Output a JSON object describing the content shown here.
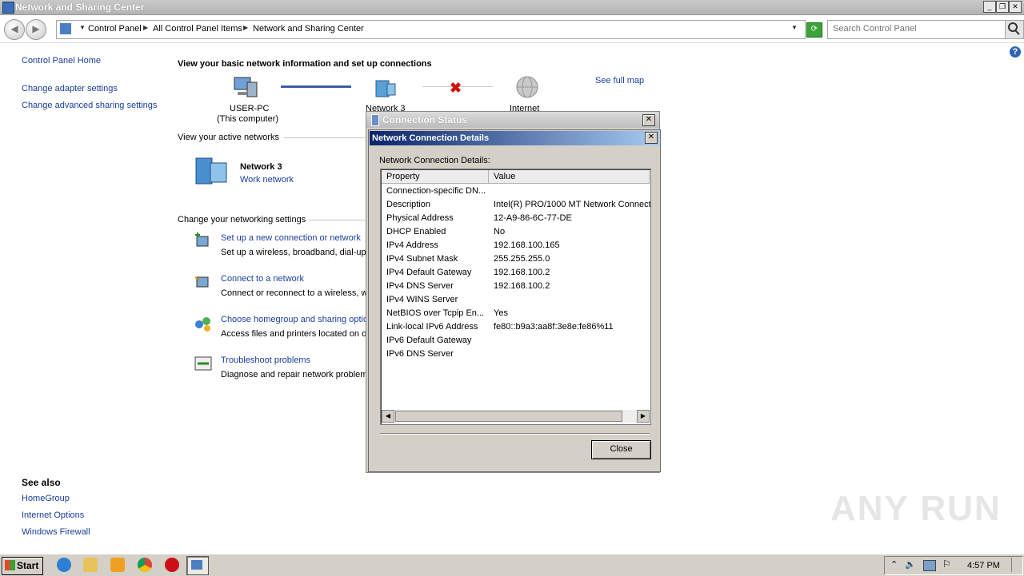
{
  "window": {
    "title": "Network and Sharing Center"
  },
  "address_bar": {
    "crumbs": [
      "Control Panel",
      "All Control Panel Items",
      "Network and Sharing Center"
    ],
    "search_placeholder": "Search Control Panel"
  },
  "left_pane": {
    "links": [
      "Control Panel Home",
      "Change adapter settings",
      "Change advanced sharing settings"
    ],
    "see_also_title": "See also",
    "see_also": [
      "HomeGroup",
      "Internet Options",
      "Windows Firewall"
    ]
  },
  "main": {
    "heading": "View your basic network information and set up connections",
    "see_full_map": "See full map",
    "map": {
      "computer_name": "USER-PC",
      "computer_sub": "(This computer)",
      "network": "Network  3",
      "internet": "Internet"
    },
    "active_networks_label": "View your active networks",
    "active_network": {
      "name": "Network  3",
      "type": "Work network"
    },
    "change_settings_label": "Change your networking settings",
    "tasks": [
      {
        "title": "Set up a new connection or network",
        "desc": "Set up a wireless, broadband, dial-up"
      },
      {
        "title": "Connect to a network",
        "desc": "Connect or reconnect to a wireless, w"
      },
      {
        "title": "Choose homegroup and sharing optio",
        "desc": "Access files and printers located on ot"
      },
      {
        "title": "Troubleshoot problems",
        "desc": "Diagnose and repair network problem"
      }
    ]
  },
  "status_dialog": {
    "title": "Connection Status"
  },
  "details_dialog": {
    "title": "Network Connection Details",
    "label": "Network Connection Details:",
    "columns": [
      "Property",
      "Value"
    ],
    "rows": [
      {
        "p": "Connection-specific DN...",
        "v": ""
      },
      {
        "p": "Description",
        "v": "Intel(R) PRO/1000 MT Network Connect"
      },
      {
        "p": "Physical Address",
        "v": "12-A9-86-6C-77-DE"
      },
      {
        "p": "DHCP Enabled",
        "v": "No"
      },
      {
        "p": "IPv4 Address",
        "v": "192.168.100.165"
      },
      {
        "p": "IPv4 Subnet Mask",
        "v": "255.255.255.0"
      },
      {
        "p": "IPv4 Default Gateway",
        "v": "192.168.100.2"
      },
      {
        "p": "IPv4 DNS Server",
        "v": "192.168.100.2"
      },
      {
        "p": "IPv4 WINS Server",
        "v": ""
      },
      {
        "p": "NetBIOS over Tcpip En...",
        "v": "Yes"
      },
      {
        "p": "Link-local IPv6 Address",
        "v": "fe80::b9a3:aa8f:3e8e:fe86%11"
      },
      {
        "p": "IPv6 Default Gateway",
        "v": ""
      },
      {
        "p": "IPv6 DNS Server",
        "v": ""
      }
    ],
    "close_label": "Close"
  },
  "taskbar": {
    "start_label": "Start",
    "clock": "4:57 PM"
  },
  "watermark": "ANY RUN"
}
